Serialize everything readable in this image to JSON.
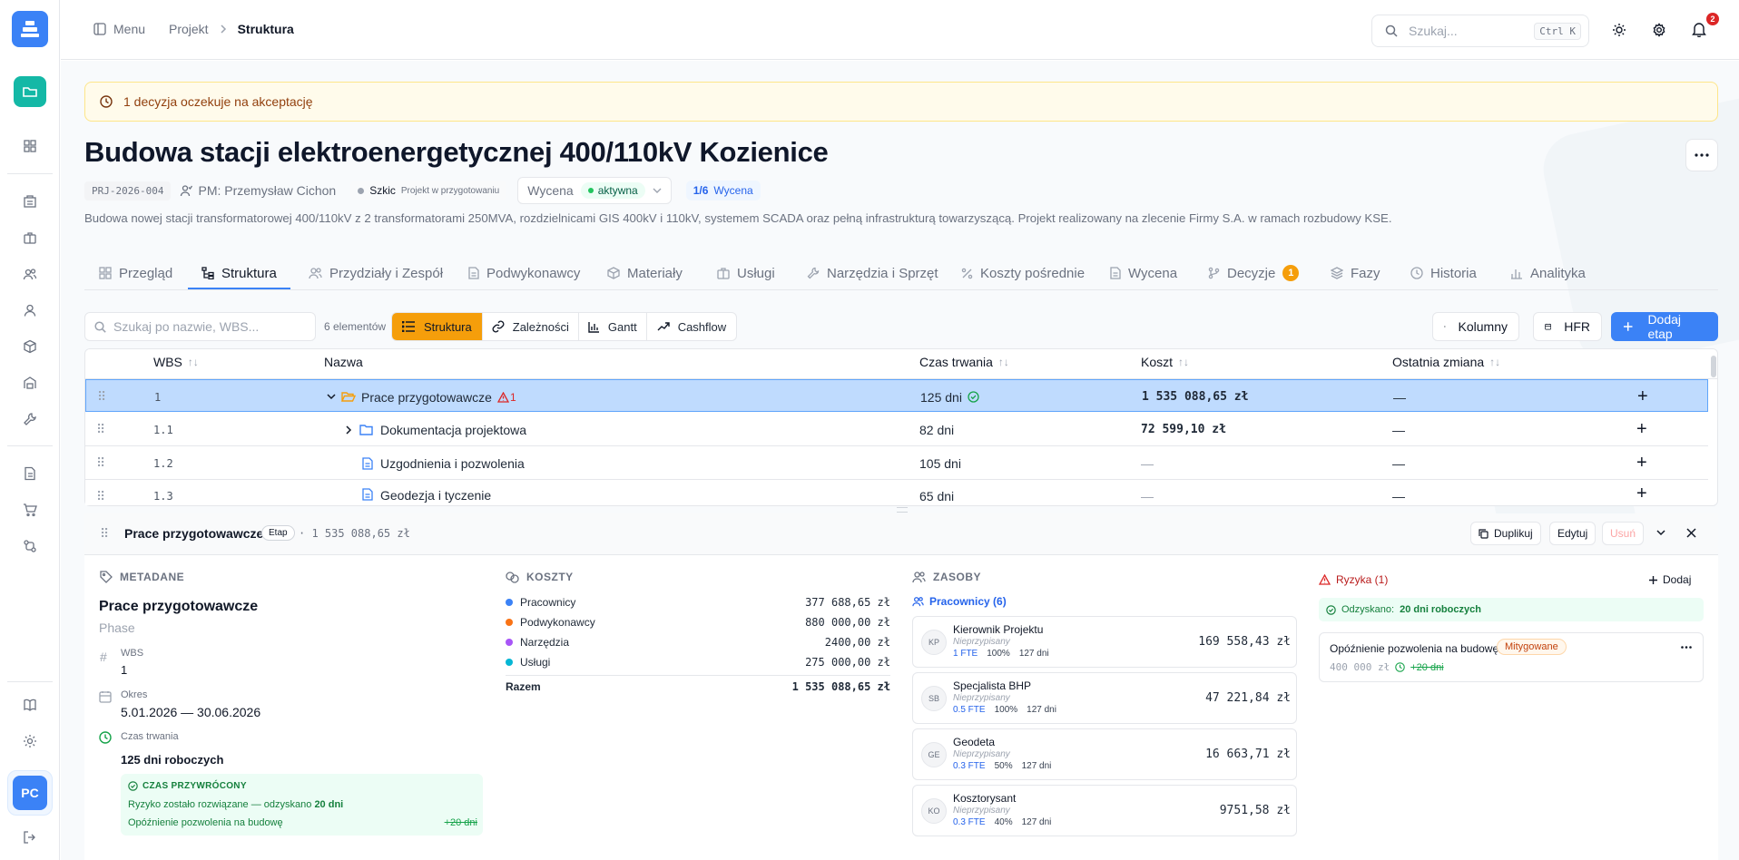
{
  "header": {
    "menu_label": "Menu",
    "breadcrumb": [
      "Projekt",
      "Struktura"
    ],
    "search_placeholder": "Szukaj...",
    "search_shortcut": "Ctrl K",
    "notification_count": "2"
  },
  "alert": {
    "text": "1 decyzja oczekuje na akceptację"
  },
  "project": {
    "title": "Budowa stacji elektroenergetycznej 400/110kV Kozienice",
    "code": "PRJ-2026-004",
    "pm": "PM: Przemysław Cichon",
    "status_label": "Szkic",
    "status_sub": "Projekt w przygotowaniu",
    "stage_label": "Wycena",
    "stage_state": "aktywna",
    "step": "1/6",
    "step_label": "Wycena",
    "description": "Budowa nowej stacji transformatorowej 400/110kV z 2 transformatorami 250MVA, rozdzielnicami GIS 400kV i 110kV, systemem SCADA oraz pełną infrastrukturą towarzyszącą. Projekt realizowany na zlecenie Firmy S.A. w ramach rozbudowy KSE."
  },
  "tabs": [
    {
      "label": "Przegląd",
      "icon": "grid-icon"
    },
    {
      "label": "Struktura",
      "icon": "tree-icon",
      "active": true
    },
    {
      "label": "Przydziały i Zespół",
      "icon": "users-icon"
    },
    {
      "label": "Podwykonawcy",
      "icon": "document-icon"
    },
    {
      "label": "Materiały",
      "icon": "box-icon"
    },
    {
      "label": "Usługi",
      "icon": "briefcase-icon"
    },
    {
      "label": "Narzędzia i Sprzęt",
      "icon": "wrench-icon"
    },
    {
      "label": "Koszty pośrednie",
      "icon": "percent-icon"
    },
    {
      "label": "Wycena",
      "icon": "document-icon"
    },
    {
      "label": "Decyzje",
      "icon": "branch-icon",
      "badge": "1"
    },
    {
      "label": "Fazy",
      "icon": "layers-icon"
    },
    {
      "label": "Historia",
      "icon": "clock-icon"
    },
    {
      "label": "Analityka",
      "icon": "chart-icon"
    }
  ],
  "toolbar": {
    "search_placeholder": "Szukaj po nazwie, WBS...",
    "count": "6 elementów",
    "views": [
      "Struktura",
      "Zależności",
      "Gantt",
      "Cashflow"
    ],
    "columns_label": "Kolumny",
    "hfr_label": "HFR",
    "add_label": "Dodaj etap"
  },
  "table": {
    "headers": {
      "wbs": "WBS",
      "name": "Nazwa",
      "duration": "Czas trwania",
      "cost": "Koszt",
      "last_change": "Ostatnia zmiana"
    },
    "rows": [
      {
        "wbs": "1",
        "name": "Prace przygotowawcze",
        "risk": "1",
        "duration": "125 dni",
        "cost": "1 535 088,65 zł",
        "last": "—"
      },
      {
        "wbs": "1.1",
        "name": "Dokumentacja projektowa",
        "duration": "82 dni",
        "cost": "72 599,10 zł",
        "last": "—"
      },
      {
        "wbs": "1.2",
        "name": "Uzgodnienia i pozwolenia",
        "duration": "105 dni",
        "cost": "—",
        "last": "—"
      },
      {
        "wbs": "1.3",
        "name": "Geodezja i tyczenie",
        "duration": "65 dni",
        "cost": "—",
        "last": "—"
      }
    ]
  },
  "detail": {
    "title": "Prace przygotowawcze",
    "badge": "Etap",
    "amount": "· 1 535 088,65 zł",
    "actions": {
      "duplicate": "Duplikuj",
      "edit": "Edytuj",
      "delete": "Usuń"
    },
    "metadata": {
      "section": "METADANE",
      "name": "Prace przygotowawcze",
      "type": "Phase",
      "wbs_label": "WBS",
      "wbs": "1",
      "period_label": "Okres",
      "period": "5.01.2026 — 30.06.2026",
      "duration_label": "Czas trwania",
      "duration": "125 dni roboczych",
      "restored_title": "CZAS PRZYWRÓCONY",
      "restored_text": "Ryzyko zostało rozwiązane — odzyskano",
      "restored_days": "20 dni",
      "restored_item": "Opóźnienie pozwolenia na budowę",
      "restored_item_days": "+20 dni"
    },
    "costs": {
      "section": "KOSZTY",
      "items": [
        {
          "label": "Pracownicy",
          "value": "377 688,65 zł",
          "color": "#3b82f6"
        },
        {
          "label": "Podwykonawcy",
          "value": "880 000,00 zł",
          "color": "#f97316"
        },
        {
          "label": "Narzędzia",
          "value": "2400,00 zł",
          "color": "#a855f7"
        },
        {
          "label": "Usługi",
          "value": "275 000,00 zł",
          "color": "#06b6d4"
        }
      ],
      "total_label": "Razem",
      "total": "1 535 088,65 zł"
    },
    "resources": {
      "section": "ZASOBY",
      "workers_label": "Pracownicy (6)",
      "items": [
        {
          "initials": "KP",
          "name": "Kierownik Projektu",
          "sub": "Nieprzypisany",
          "fte": "1 FTE",
          "pct": "100%",
          "days": "127 dni",
          "amount": "169 558,43 zł"
        },
        {
          "initials": "SB",
          "name": "Specjalista BHP",
          "sub": "Nieprzypisany",
          "fte": "0.5 FTE",
          "pct": "100%",
          "days": "127 dni",
          "amount": "47 221,84 zł"
        },
        {
          "initials": "GE",
          "name": "Geodeta",
          "sub": "Nieprzypisany",
          "fte": "0.3 FTE",
          "pct": "50%",
          "days": "127 dni",
          "amount": "16 663,71 zł"
        },
        {
          "initials": "KO",
          "name": "Kosztorysant",
          "sub": "Nieprzypisany",
          "fte": "0.3 FTE",
          "pct": "40%",
          "days": "127 dni",
          "amount": "9751,58 zł"
        }
      ]
    },
    "risks": {
      "title": "Ryzyka (1)",
      "add_label": "Dodaj",
      "recovered_prefix": "Odzyskano:",
      "recovered_days": "20 dni roboczych",
      "item_name": "Opóźnienie pozwolenia na budowę",
      "item_status": "Mitygowane",
      "item_amount": "400 000 zł",
      "item_days": "+20 dni"
    }
  },
  "user": {
    "initials": "PC"
  },
  "colors": {
    "accent": "#3b82f6",
    "warn": "#f59e0b",
    "teal": "#14b8a6",
    "danger": "#dc2626",
    "success": "#16a34a"
  }
}
